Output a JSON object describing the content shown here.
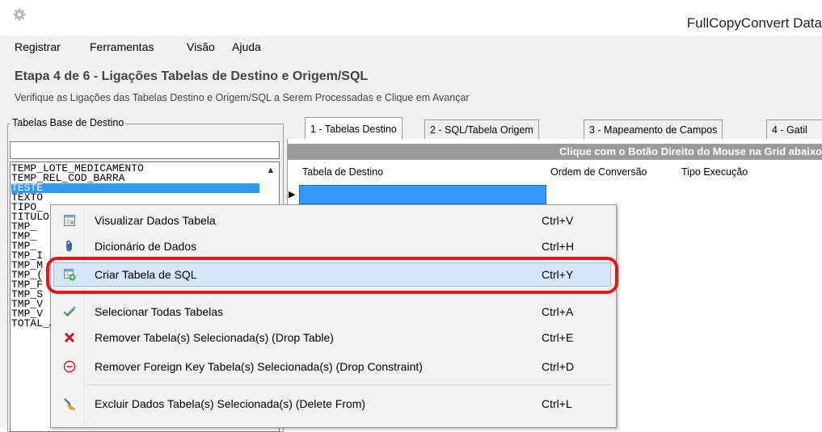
{
  "window": {
    "title": "FullCopyConvert Data"
  },
  "menu": [
    "Registrar",
    "Ferramentas",
    "Visão",
    "Ajuda"
  ],
  "step": {
    "title": "Etapa 4 de 6 - Ligações Tabelas de Destino e Origem/SQL",
    "subtitle": "Verifique as Ligações das Tabelas Destino e Origem/SQL a Serem Processadas e Clique em Avançar"
  },
  "left_panel": {
    "group_label": "Tabelas Base de Destino",
    "filter_value": "",
    "items": [
      "TEMP_LOTE_MEDICAMENTO",
      "TEMP_REL_COD_BARRA",
      "TESTE",
      "TEXTO",
      "TIPO_",
      "TITULO",
      "TMP_",
      "TMP_",
      "TMP_",
      "TMP_I",
      "TMP_M",
      "TMP_(",
      "TMP_F",
      "TMP_S",
      "TMP_V",
      "TMP_V",
      "TOTAL_A_RESTOS"
    ],
    "selected_index": 2
  },
  "tabs": [
    {
      "label": "1 - Tabelas Destino",
      "active": true
    },
    {
      "label": "2 - SQL/Tabela Origem",
      "active": false
    },
    {
      "label": "3 - Mapeamento de Campos",
      "active": false
    },
    {
      "label": "4 - Gatil",
      "active": false
    }
  ],
  "grid": {
    "hint": "Clique com o Botão Direito do Mouse na Grid abaixo",
    "columns": [
      "Tabela de Destino",
      "Ordem de Conversão",
      "Tipo Execução"
    ],
    "row_indicator": "▶"
  },
  "context_menu": {
    "items": [
      {
        "label": "Visualizar Dados Tabela",
        "shortcut": "Ctrl+V",
        "icon": "table-view-icon"
      },
      {
        "label": "Dicionário de Dados",
        "shortcut": "Ctrl+H",
        "icon": "paperclip-icon"
      },
      {
        "label": "Criar Tabela de SQL",
        "shortcut": "Ctrl+Y",
        "icon": "table-add-icon",
        "highlighted": true
      },
      {
        "label": "Selecionar Todas Tabelas",
        "shortcut": "Ctrl+A",
        "icon": "checkmark-icon"
      },
      {
        "label": "Remover Tabela(s) Selecionada(s) (Drop Table)",
        "shortcut": "Ctrl+E",
        "icon": "red-x-icon"
      },
      {
        "label": "Remover Foreign Key Tabela(s) Selecionada(s) (Drop Constraint)",
        "shortcut": "Ctrl+D",
        "icon": "minus-circle-icon"
      },
      {
        "label": "Excluir Dados Tabela(s) Selecionada(s) (Delete From)",
        "shortcut": "Ctrl+L",
        "icon": "broom-icon"
      }
    ]
  },
  "colors": {
    "selection": "#3399ff",
    "annotation": "#e8141c",
    "menu_highlight": "#d7e6f5"
  }
}
